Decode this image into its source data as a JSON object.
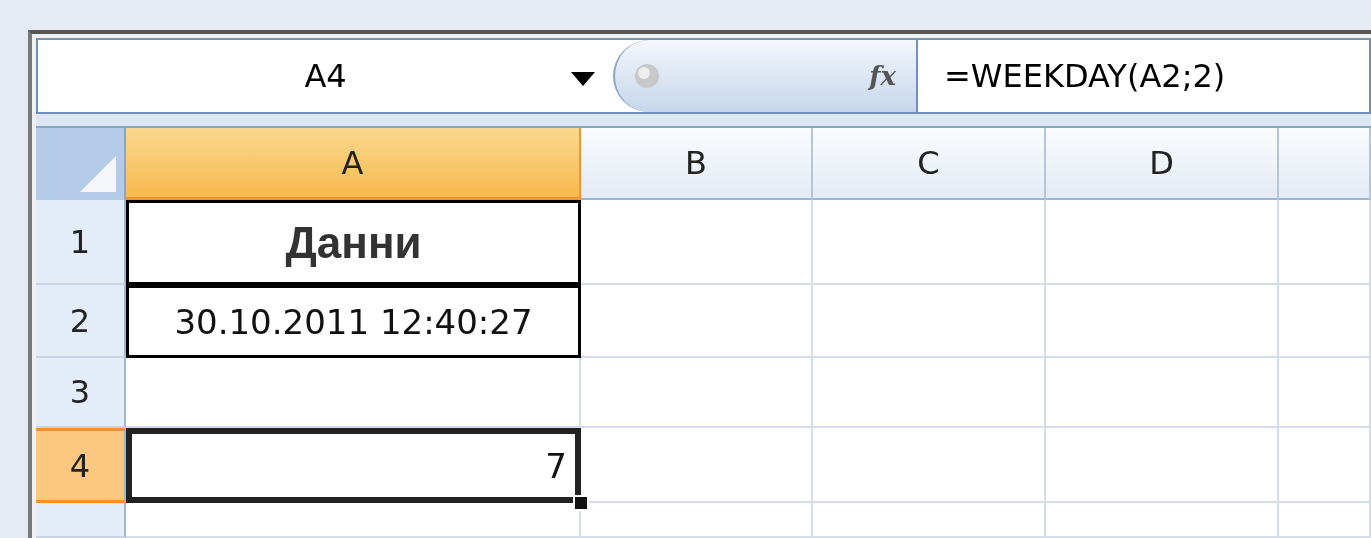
{
  "name_box": {
    "value": "A4"
  },
  "formula_bar": {
    "function_button": "fx",
    "value": "=WEEKDAY(A2;2)"
  },
  "columns": [
    {
      "label": "A",
      "selected": true
    },
    {
      "label": "B",
      "selected": false
    },
    {
      "label": "C",
      "selected": false
    },
    {
      "label": "D",
      "selected": false
    }
  ],
  "rows": [
    {
      "label": "1",
      "selected": false,
      "cells": [
        {
          "kind": "heading",
          "text": "Данни",
          "selected": false
        }
      ]
    },
    {
      "label": "2",
      "selected": false,
      "cells": [
        {
          "kind": "date",
          "text": "30.10.2011 12:40:27",
          "selected": false
        }
      ]
    },
    {
      "label": "3",
      "selected": false,
      "cells": []
    },
    {
      "label": "4",
      "selected": true,
      "cells": [
        {
          "kind": "number",
          "text": "7",
          "selected": true
        }
      ]
    }
  ]
}
